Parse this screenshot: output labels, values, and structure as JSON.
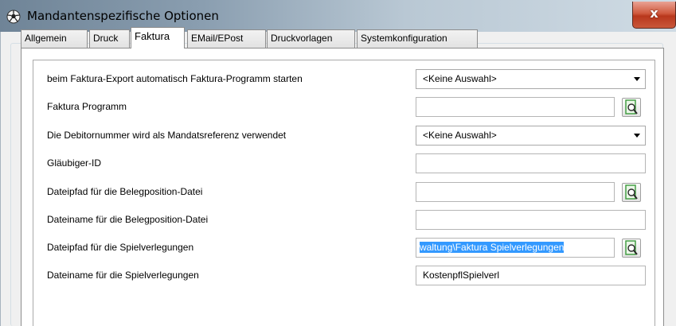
{
  "window": {
    "title": "Mandantenspezifische Optionen",
    "close_label": "x"
  },
  "tabs": [
    {
      "label": "Allgemein"
    },
    {
      "label": "Druck"
    },
    {
      "label": "Faktura",
      "active": true
    },
    {
      "label": "EMail/EPost"
    },
    {
      "label": "Druckvorlagen"
    },
    {
      "label": "Systemkonfiguration"
    }
  ],
  "fields": [
    {
      "label": "beim Faktura-Export automatisch Faktura-Programm starten",
      "type": "combo",
      "value": "<Keine Auswahl>"
    },
    {
      "label": "Faktura Programm",
      "type": "browse",
      "value": ""
    },
    {
      "label": "Die Debitornummer wird als Mandatsreferenz verwendet",
      "type": "combo",
      "value": "<Keine Auswahl>"
    },
    {
      "label": "Gläubiger-ID",
      "type": "text",
      "value": ""
    },
    {
      "label": "Dateipfad für die Belegposition-Datei",
      "type": "browse",
      "value": ""
    },
    {
      "label": "Dateiname für die Belegposition-Datei",
      "type": "text",
      "value": ""
    },
    {
      "label": "Dateipfad für die Spielverlegungen",
      "type": "browse",
      "value": "waltung\\Faktura Spielverlegungen",
      "selected": true
    },
    {
      "label": "Dateiname für die Spielverlegungen",
      "type": "text",
      "value": "KostenpflSpielverl"
    }
  ],
  "colors": {
    "selection": "#3399ff",
    "close_button": "#c8462a",
    "browse_icon": "#3a9a3a"
  }
}
